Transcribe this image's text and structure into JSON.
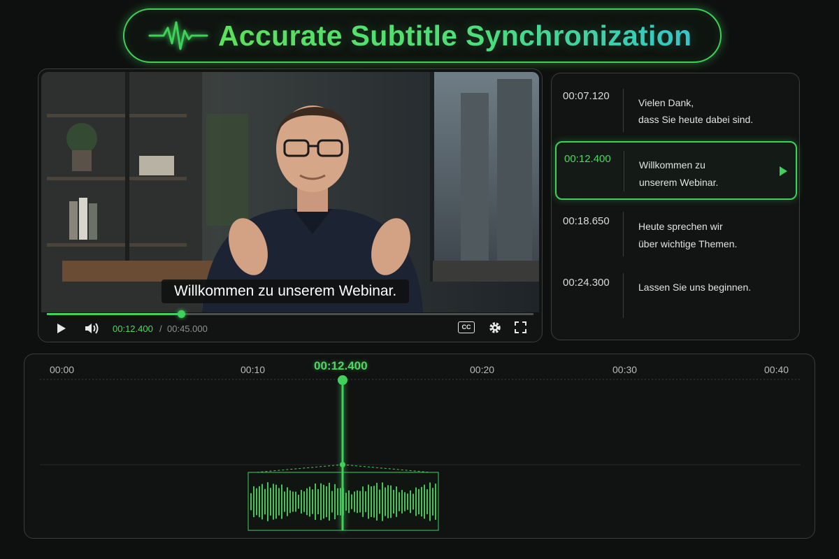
{
  "header": {
    "title": "Accurate Subtitle Synchronization",
    "icon": "waveform-pulse-icon"
  },
  "player": {
    "subtitle": "Willkommen zu unserem Webinar.",
    "current_time": "00:12.400",
    "separator": "/",
    "duration": "00:45.000",
    "progress": 0.2756,
    "controls": [
      "play-icon",
      "volume-icon",
      "cc-icon",
      "gear-icon",
      "fullscreen-icon"
    ],
    "cc_label": "CC"
  },
  "subtitles": [
    {
      "time": "00:07.120",
      "line1": "Vielen Dank,",
      "line2": "dass Sie heute dabei sind.",
      "active": false
    },
    {
      "time": "00:12.400",
      "line1": "Willkommen zu",
      "line2": "unserem Webinar.",
      "active": true
    },
    {
      "time": "00:18.650",
      "line1": "Heute sprechen wir",
      "line2": "über wichtige Themen.",
      "active": false
    },
    {
      "time": "00:24.300",
      "line1": "Lassen Sie uns beginnen.",
      "line2": "",
      "active": false
    }
  ],
  "timeline": {
    "ticks": [
      "00:00",
      "00:10",
      "00:20",
      "00:30",
      "00:40"
    ],
    "playhead_time": "00:12.400"
  },
  "colors": {
    "accent": "#3fd15a",
    "wave_start": "#2aa6d6",
    "wave_mid": "#3fd15a",
    "wave_end": "#c6d84a"
  }
}
